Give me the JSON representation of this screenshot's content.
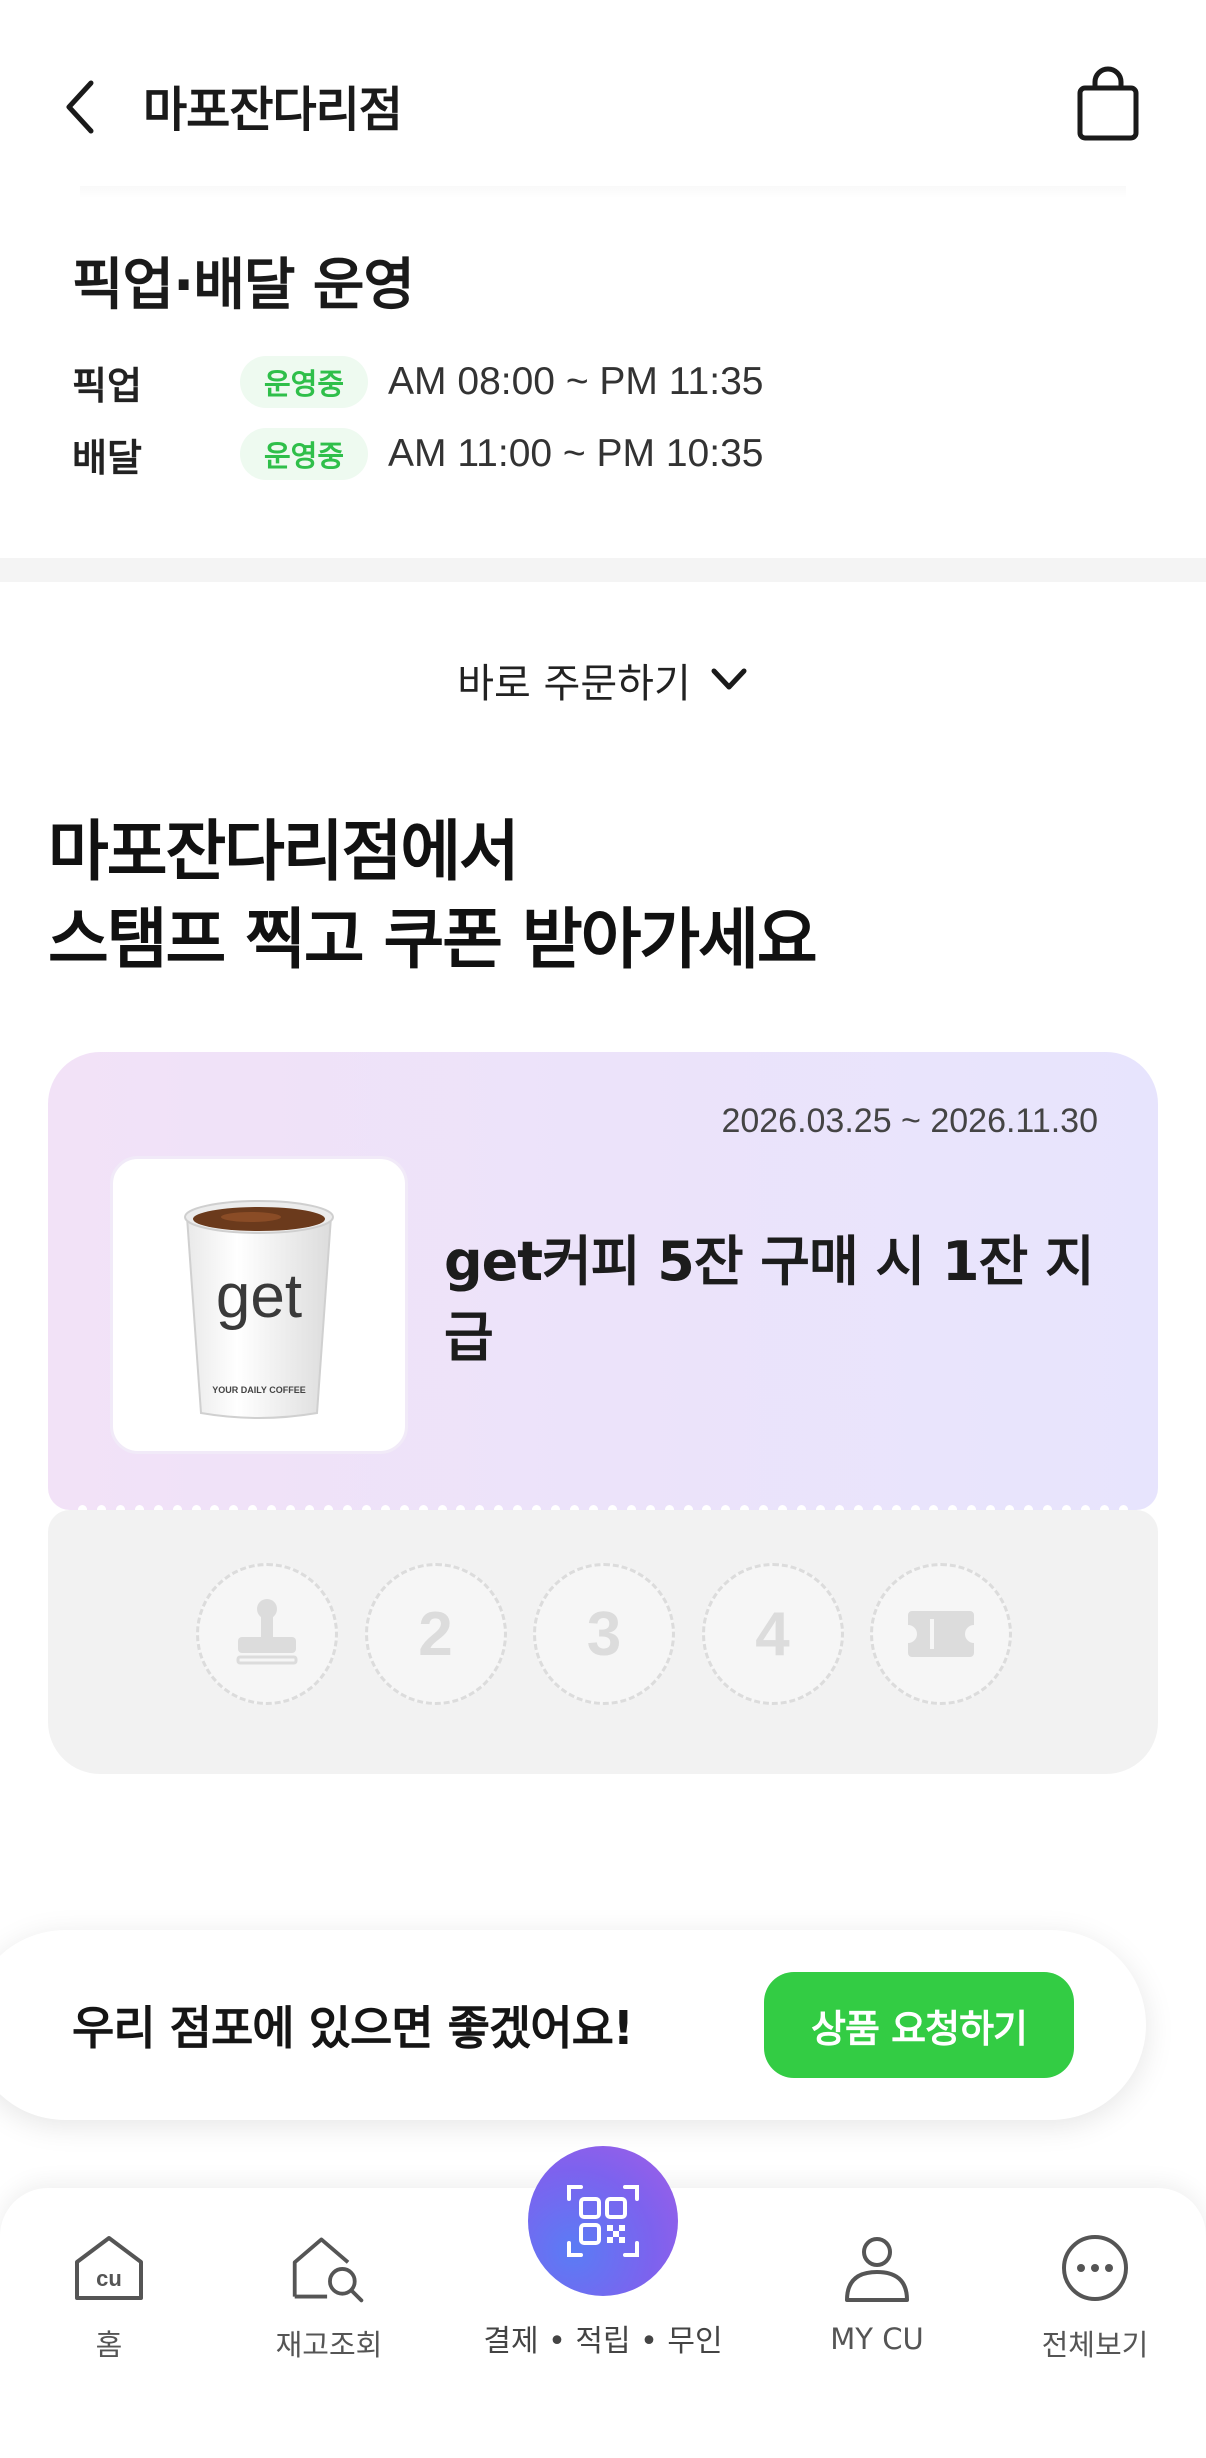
{
  "header": {
    "store_name": "마포잔다리점",
    "back_icon": "back-arrow-icon",
    "cart_icon": "shopping-bag-icon"
  },
  "operation": {
    "title": "픽업·배달 운영",
    "rows": [
      {
        "label": "픽업",
        "status": "운영중",
        "hours": "AM 08:00 ~ PM 11:35"
      },
      {
        "label": "배달",
        "status": "운영중",
        "hours": "AM 11:00 ~ PM 10:35"
      }
    ]
  },
  "quick_order": {
    "label": "바로 주문하기",
    "icon": "chevron-down-icon"
  },
  "stamp_section": {
    "headline_line1": "마포잔다리점에서",
    "headline_line2": "스탬프 찍고 쿠폰 받아가세요"
  },
  "coupon": {
    "period": "2026.03.25 ~ 2026.11.30",
    "product_name": "get커피 5잔 구매 시 1잔 지급",
    "product_image_text": "get",
    "product_image_subtext": "YOUR DAILY COFFEE",
    "stamps": [
      {
        "type": "icon",
        "icon": "stamp-icon"
      },
      {
        "type": "number",
        "value": "2"
      },
      {
        "type": "number",
        "value": "3"
      },
      {
        "type": "number",
        "value": "4"
      },
      {
        "type": "icon",
        "icon": "ticket-icon"
      }
    ]
  },
  "request_banner": {
    "text": "우리 점포에 있으면 좋겠어요!",
    "button_label": "상품 요청하기"
  },
  "bottom_nav": {
    "items": [
      {
        "label": "홈",
        "icon": "cu-home-icon"
      },
      {
        "label": "재고조회",
        "icon": "stock-search-icon"
      },
      {
        "label": "결제 • 적립 • 무인",
        "icon": "qr-code-icon"
      },
      {
        "label": "MY CU",
        "icon": "person-icon"
      },
      {
        "label": "전체보기",
        "icon": "more-icon"
      }
    ]
  },
  "colors": {
    "accent_green": "#33cc44",
    "badge_green_text": "#2fbf4a",
    "card_gradient_start": "#f2e2f7",
    "card_gradient_end": "#e7e4fd",
    "nav_center_gradient": "#7d62ee"
  }
}
